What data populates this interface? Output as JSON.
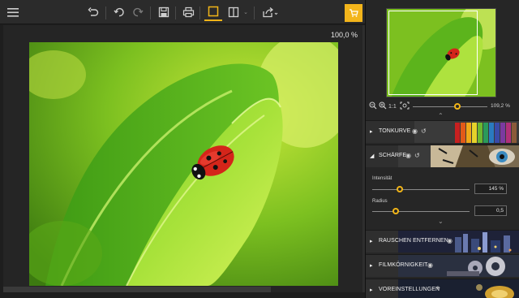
{
  "toolbar": {
    "menu_icon": "hamburger-menu-icon",
    "buttons": [
      "undo-icon",
      "undo-step-icon",
      "redo-icon",
      "save-icon",
      "print-icon",
      "single-view-icon",
      "split-view-icon",
      "export-icon"
    ],
    "cart_icon": "cart-icon"
  },
  "canvas": {
    "zoom_readout": "100,0 %"
  },
  "navigator": {
    "zoom_value": "109,2 %",
    "zoom_level_fraction": 0.6
  },
  "sections": [
    {
      "label": "TONKURVE",
      "expanded": false
    },
    {
      "label": "SCHÄRFE",
      "expanded": true
    },
    {
      "label": "RAUSCHEN ENTFERNEN",
      "expanded": false
    },
    {
      "label": "FILMKÖRNIGKEIT",
      "expanded": false
    },
    {
      "label": "VOREINSTELLUNGEN",
      "expanded": false
    }
  ],
  "sharpness": {
    "intensity_label": "Intensität",
    "intensity_value": "145 %",
    "intensity_fraction": 0.28,
    "radius_label": "Radius",
    "radius_value": "0,5",
    "radius_fraction": 0.24
  },
  "colors": {
    "accent": "#f2b518",
    "cart_bg": "#f3b51b",
    "panel_bg": "#262626",
    "toolbar_bg": "#2b2b2b"
  }
}
